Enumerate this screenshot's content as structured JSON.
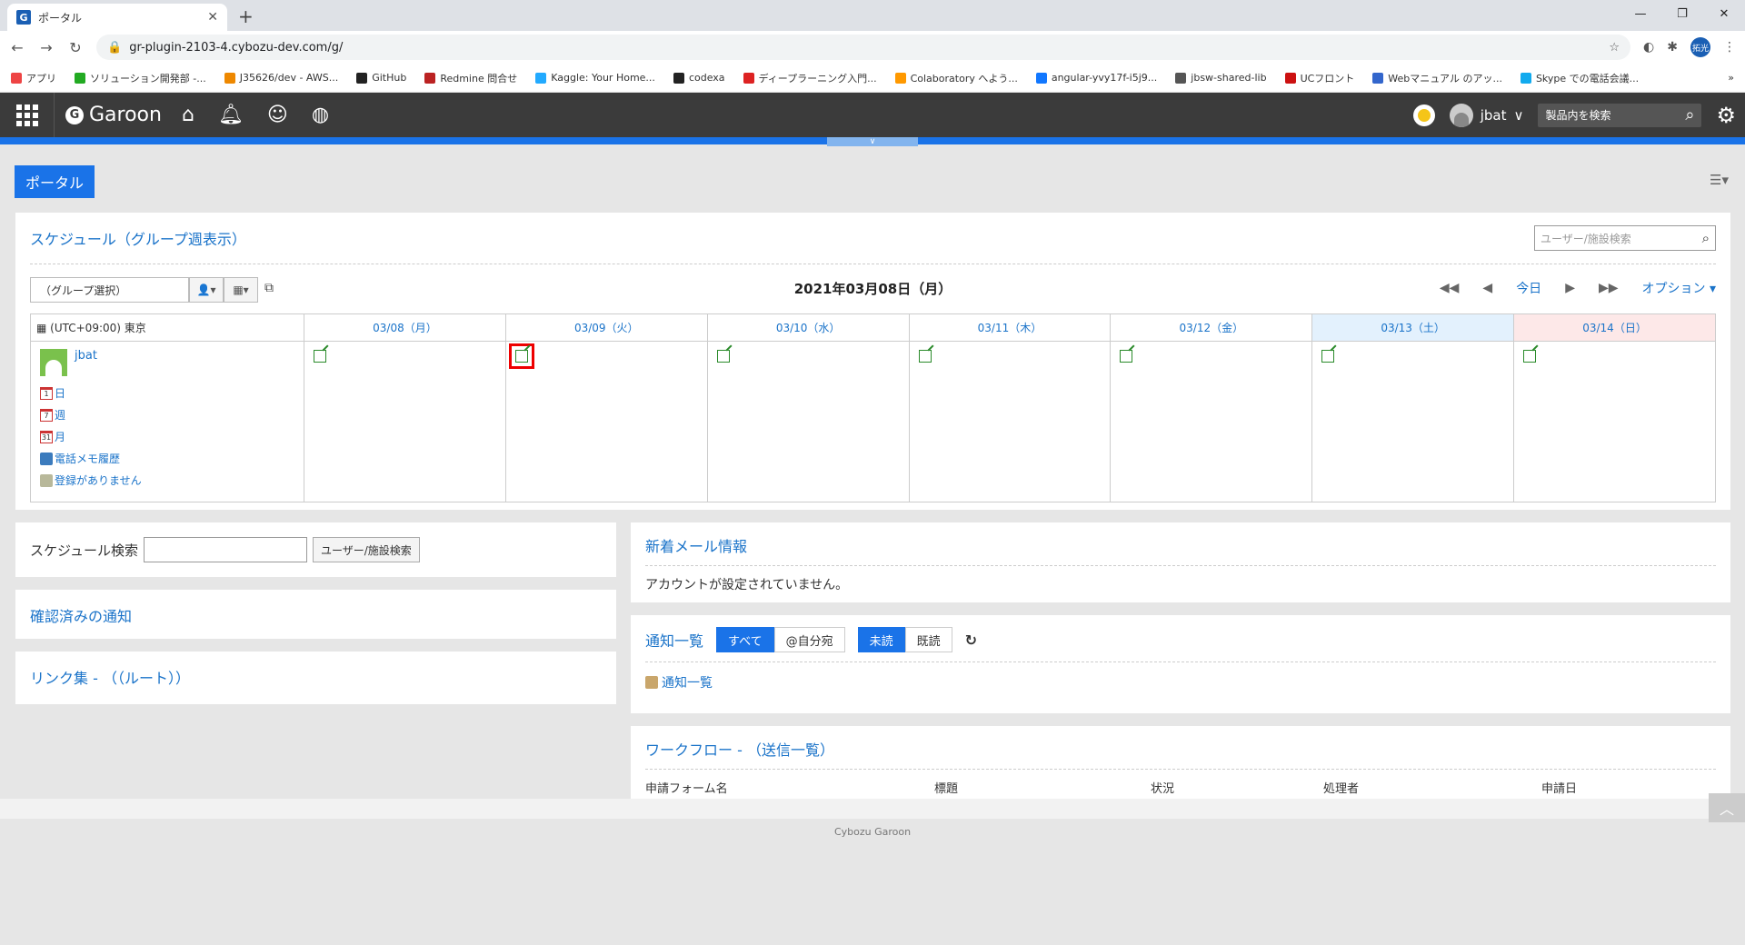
{
  "browser": {
    "tab_title": "ポータル",
    "url": "gr-plugin-2103-4.cybozu-dev.com/g/",
    "profile": "拓光"
  },
  "bookmarks": [
    {
      "label": "アプリ",
      "color": "#e44"
    },
    {
      "label": "ソリューション開発部 -...",
      "color": "#2a2"
    },
    {
      "label": "J35626/dev - AWS...",
      "color": "#e80"
    },
    {
      "label": "GitHub",
      "color": "#222"
    },
    {
      "label": "Redmine 問合せ",
      "color": "#b22"
    },
    {
      "label": "Kaggle: Your Home...",
      "color": "#2af"
    },
    {
      "label": "codexa",
      "color": "#222"
    },
    {
      "label": "ディープラーニング入門...",
      "color": "#d22"
    },
    {
      "label": "Colaboratory へよう...",
      "color": "#f90"
    },
    {
      "label": "angular-yvy17f-i5j9...",
      "color": "#17f"
    },
    {
      "label": "jbsw-shared-lib",
      "color": "#555"
    },
    {
      "label": "UCフロント",
      "color": "#c11"
    },
    {
      "label": "Webマニュアル のアッ...",
      "color": "#36c"
    },
    {
      "label": "Skype での電話会議...",
      "color": "#1ae"
    }
  ],
  "header": {
    "logo": "Garoon",
    "user": "jbat",
    "search_placeholder": "製品内を検索"
  },
  "portal": {
    "title": "ポータル"
  },
  "schedule": {
    "title": "スケジュール（グループ週表示）",
    "search_placeholder": "ユーザー/施設検索",
    "group_select": "（グループ選択）",
    "date_caption": "2021年03月08日（月）",
    "today": "今日",
    "option": "オプション",
    "timezone": "(UTC+09:00) 東京",
    "days": [
      "03/08（月）",
      "03/09（火）",
      "03/10（水）",
      "03/11（木）",
      "03/12（金）",
      "03/13（土）",
      "03/14（日）"
    ],
    "user": "jbat",
    "links": {
      "day": "日",
      "week": "週",
      "month": "月",
      "phone": "電話メモ履歴",
      "noreg": "登録がありません"
    }
  },
  "search_panel": {
    "label": "スケジュール検索",
    "button": "ユーザー/施設検索"
  },
  "confirmed": {
    "title": "確認済みの通知"
  },
  "links_panel": {
    "title": "リンク集 - （（ルート））"
  },
  "mail": {
    "title": "新着メール情報",
    "message": "アカウントが設定されていません。"
  },
  "notifications": {
    "title": "通知一覧",
    "all": "すべて",
    "mine": "@自分宛",
    "unread": "未読",
    "read": "既読",
    "link": "通知一覧"
  },
  "workflow": {
    "title": "ワークフロー - （送信一覧）",
    "columns": [
      "申請フォーム名",
      "標題",
      "状況",
      "処理者",
      "申請日"
    ]
  },
  "footer": "Cybozu Garoon"
}
